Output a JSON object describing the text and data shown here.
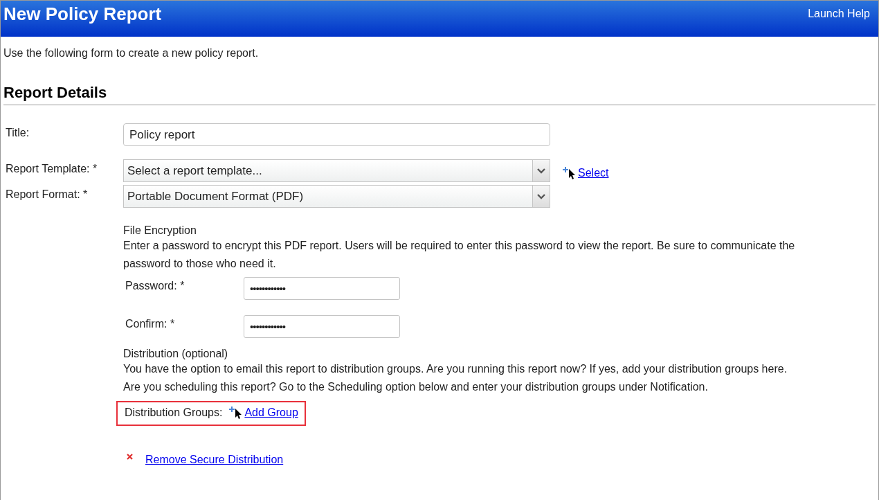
{
  "header": {
    "title": "New Policy Report",
    "help_link": "Launch Help"
  },
  "intro": "Use the following form to create a new policy report.",
  "section_title": "Report Details",
  "fields": [
    {
      "kind": "text",
      "label": "Title:",
      "value": "Policy report"
    },
    {
      "kind": "select",
      "label": "Report Template: *",
      "value": "Select a report template...",
      "action": "Select"
    },
    {
      "kind": "select",
      "label": "Report Format: *",
      "value": "Portable Document Format (PDF)"
    }
  ],
  "encryption": {
    "heading": "File Encryption",
    "lines": [
      "Enter a password to encrypt this PDF report. Users will be required to enter this password to view the report. Be sure to communicate the",
      "password to those who need it."
    ],
    "fields": [
      {
        "label": "Password: *",
        "value": "••••••••••••"
      },
      {
        "label": "Confirm: *",
        "value": "••••••••••••"
      }
    ]
  },
  "distribution": {
    "heading": "Distribution (optional)",
    "lines": [
      "You have the option to email this report to distribution groups. Are you running this report now? If yes, add your distribution groups here.",
      "Are you scheduling this report? Go to the Scheduling option below and enter your distribution groups under Notification."
    ],
    "groups_label": "Distribution Groups:",
    "add_link": "Add Group",
    "highlighted": true
  },
  "remove_link": "Remove Secure Distribution"
}
